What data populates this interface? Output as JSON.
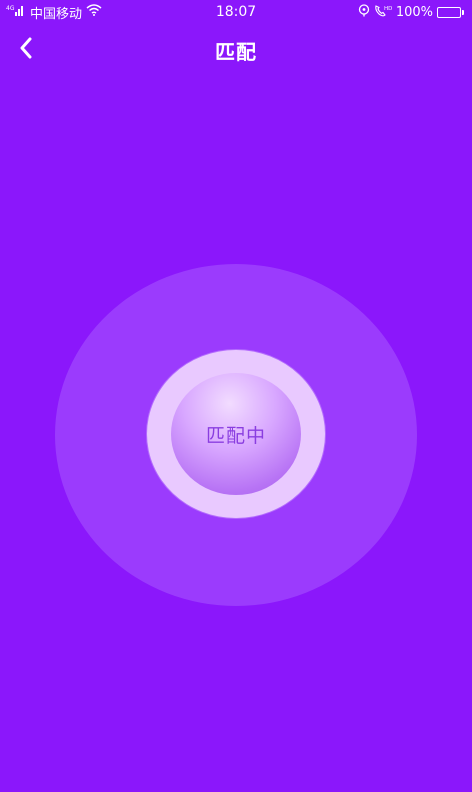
{
  "status_bar": {
    "carrier": "中国移动",
    "time": "18:07",
    "battery_percent": "100%",
    "icons": [
      "signal-icon",
      "wifi-icon",
      "location-icon",
      "hd-call-icon",
      "battery-icon"
    ]
  },
  "header": {
    "title": "匹配",
    "back_icon": "chevron-left-icon"
  },
  "match": {
    "status_label": "匹配中"
  },
  "colors": {
    "background": "#8b17fb",
    "halo": "#aa5aff",
    "ring": "#e9c9ff",
    "core_text": "#8a3ee0",
    "battery_fill": "#27e3d6"
  }
}
